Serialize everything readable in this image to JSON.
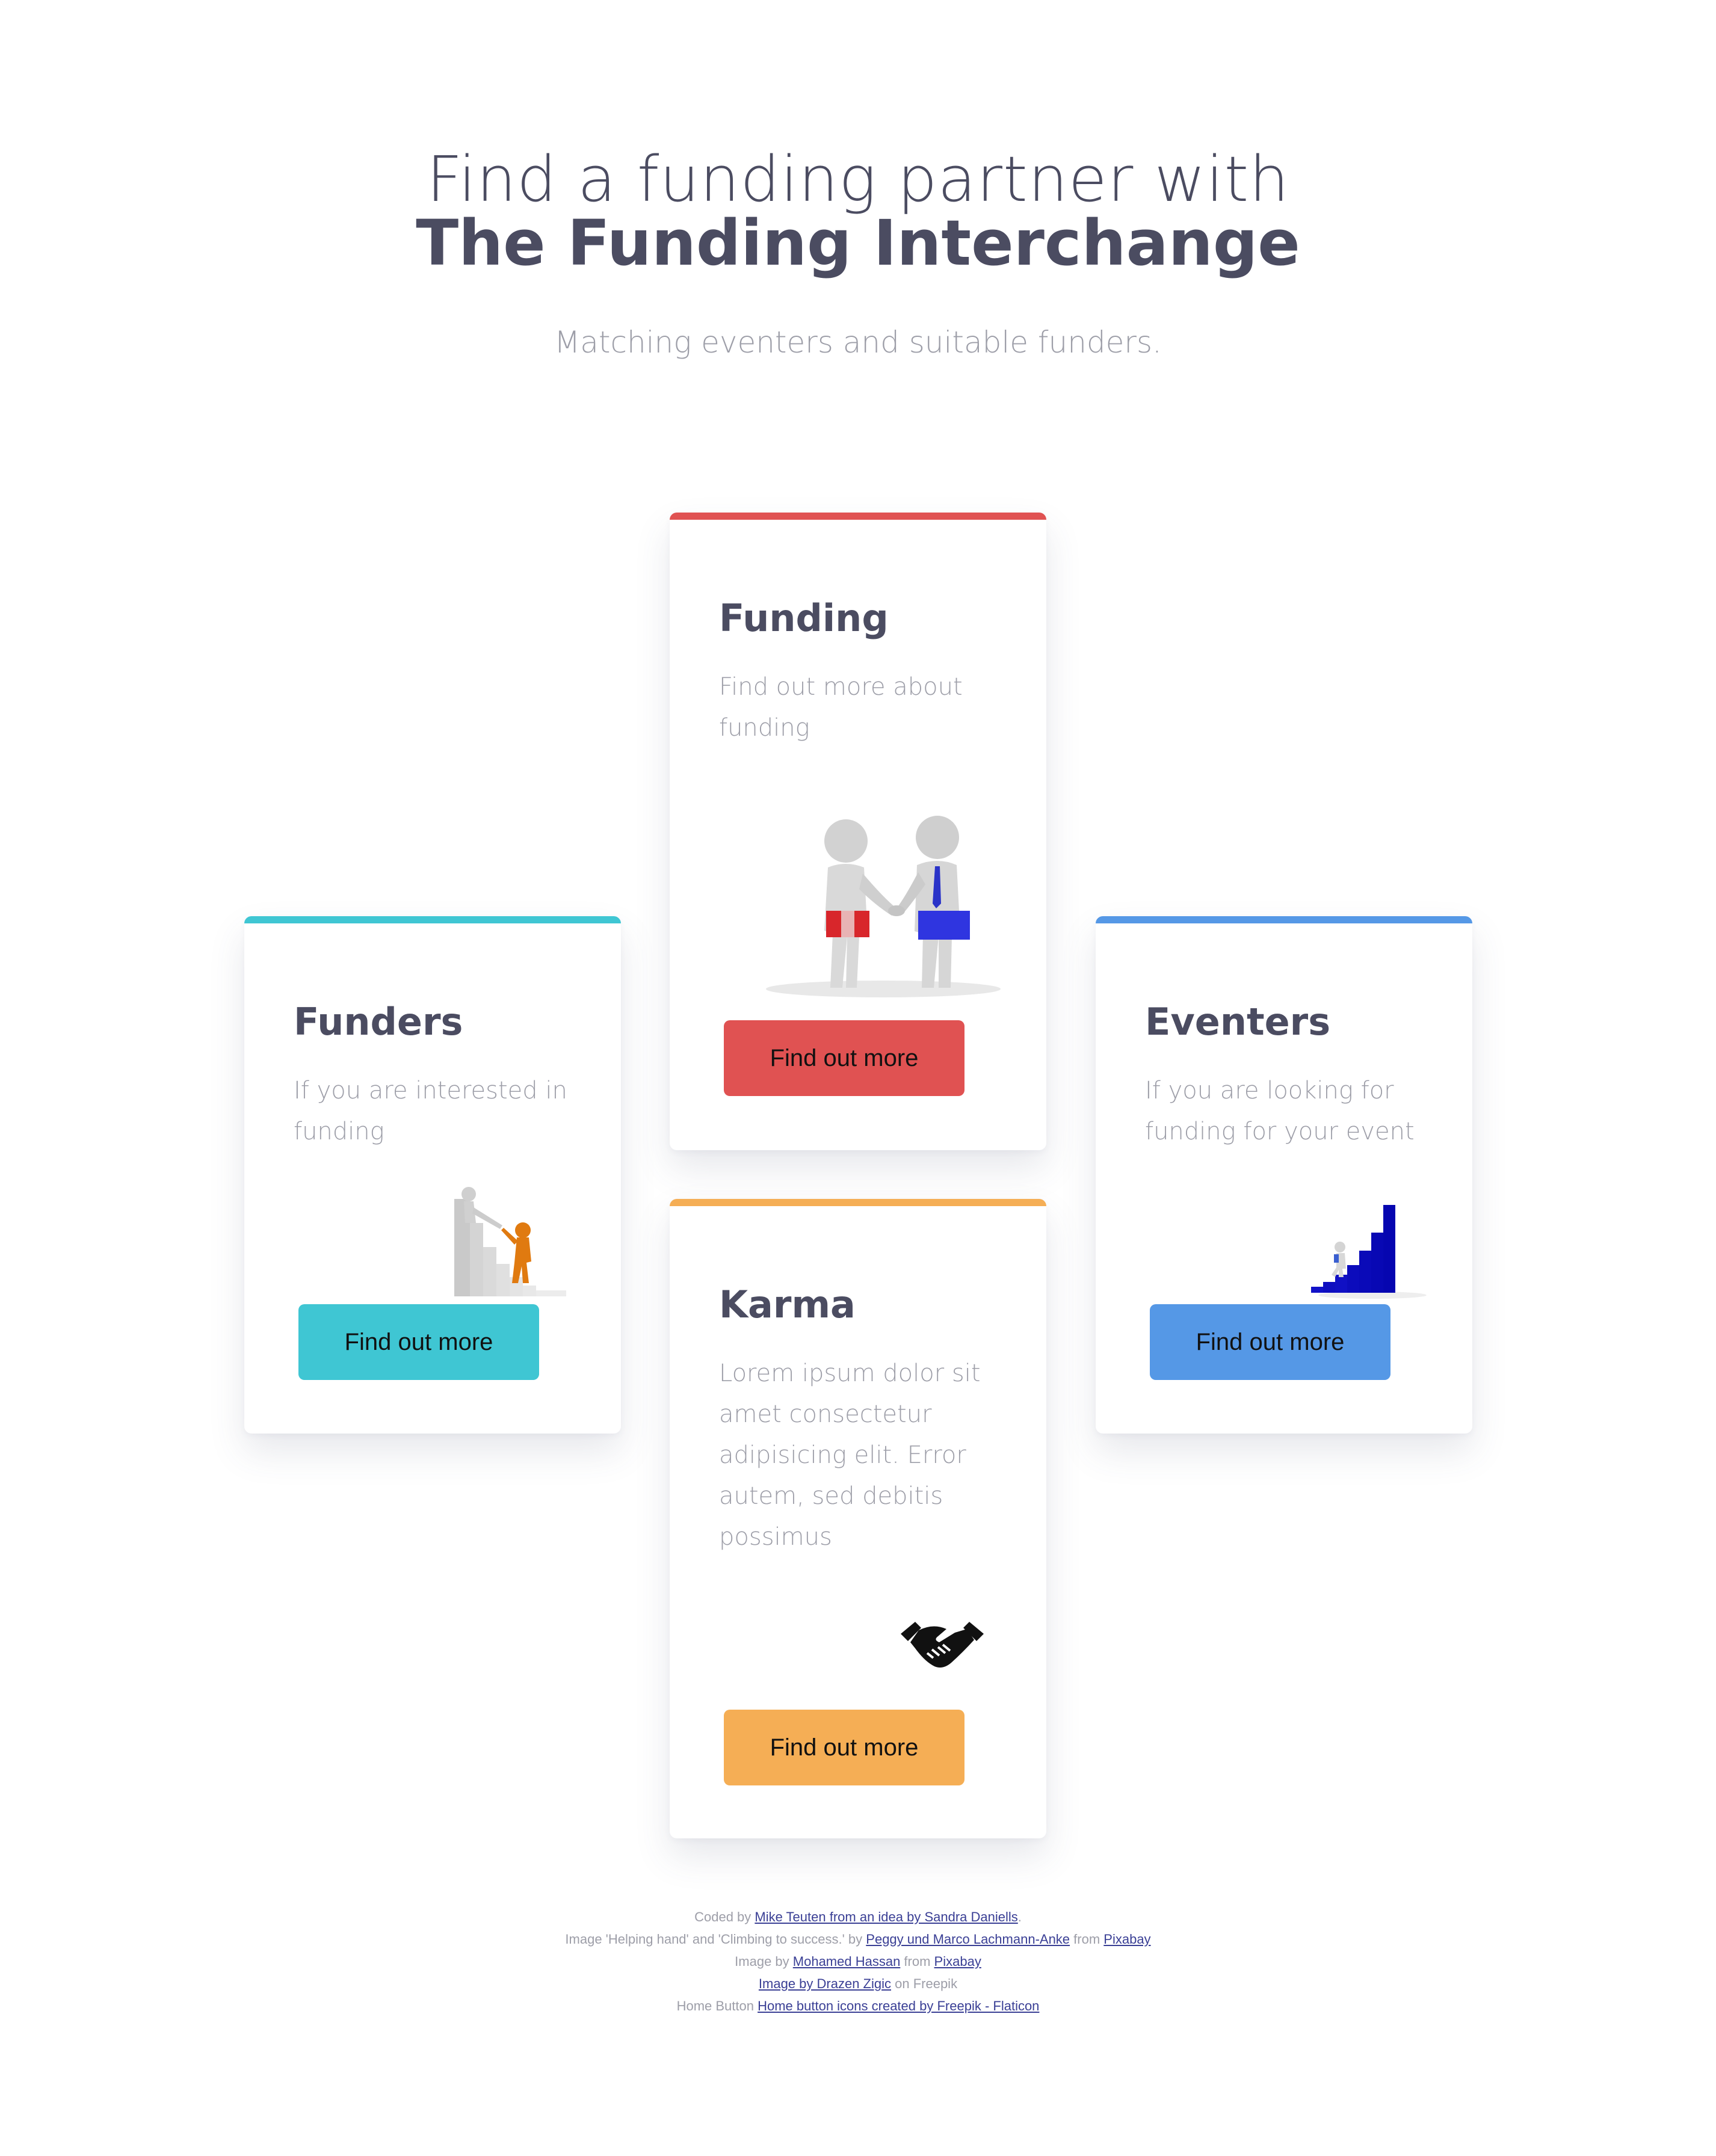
{
  "header": {
    "title_light": "Find a funding partner with",
    "title_bold": "The Funding Interchange",
    "subtitle": "Matching eventers and suitable funders."
  },
  "cards": {
    "funding": {
      "title": "Funding",
      "text": "Find out more about funding",
      "button": "Find out more",
      "accent": "#e05252",
      "icon": "handshake-people-illustration"
    },
    "funders": {
      "title": "Funders",
      "text": "If you are interested in funding",
      "button": "Find out more",
      "accent": "#3fc6d3",
      "icon": "helping-hand-illustration"
    },
    "eventers": {
      "title": "Eventers",
      "text": "If you are looking for funding for your event",
      "button": "Find out more",
      "accent": "#5598e6",
      "icon": "climbing-to-success-illustration"
    },
    "karma": {
      "title": "Karma",
      "text": "Lorem ipsum dolor sit amet consectetur adipisicing elit. Error autem, sed debitis possimus",
      "button": "Find out more",
      "accent": "#f5ae55",
      "icon": "handshake-icon"
    }
  },
  "footer": {
    "line1_prefix": "Coded by ",
    "line1_link": "Mike Teuten from an idea by Sandra Daniells",
    "line1_suffix": ".",
    "line2_prefix": "Image 'Helping hand' and 'Climbing to success.' by ",
    "line2_link1": "Peggy und Marco Lachmann-Anke",
    "line2_mid": " from ",
    "line2_link2": "Pixabay",
    "line3_prefix": "Image by ",
    "line3_link1": "Mohamed Hassan",
    "line3_mid": " from ",
    "line3_link2": "Pixabay",
    "line4_link": "Image by Drazen Zigic",
    "line4_suffix": " on Freepik",
    "line5_prefix": "Home Button ",
    "line5_link": "Home button icons created by Freepik - Flaticon"
  }
}
